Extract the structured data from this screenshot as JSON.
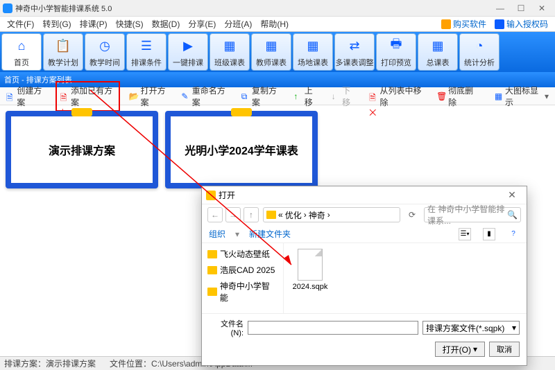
{
  "window": {
    "title": "神奇中小学智能排课系统 5.0"
  },
  "menu": {
    "file": "文件(F)",
    "goto": "转到(G)",
    "course": "排课(P)",
    "quick": "快捷(S)",
    "data": "数据(D)",
    "share": "分享(E)",
    "split": "分班(A)",
    "help": "帮助(H)",
    "buy": "购买软件",
    "enter_auth": "输入授权码"
  },
  "ribbon": {
    "home": "首页",
    "plan": "教学计划",
    "time": "教学时间",
    "cond": "排课条件",
    "auto": "一键排课",
    "class": "班级课表",
    "teacher": "教师课表",
    "venue": "场地课表",
    "adjust": "多课表调整",
    "preview": "打印预览",
    "overview": "总课表",
    "stat": "统计分析"
  },
  "breadcrumb": "首页 - 排课方案列表",
  "toolbar": {
    "create": "创建方案",
    "addexist": "添加已有方案",
    "open": "打开方案",
    "rename": "重命名方案",
    "copy": "复制方案",
    "up": "上移",
    "down": "下移",
    "remove": "从列表中移除",
    "delete": "彻底删除",
    "bigicon": "大图标显示"
  },
  "cards": {
    "demo": "演示排课方案",
    "guangming": "光明小学2024学年课表"
  },
  "status": {
    "plan_lbl": "排课方案：",
    "plan_val": "演示排课方案",
    "path_lbl": "文件位置：",
    "path_val": "C:\\Users\\admin\\AppData\\..."
  },
  "dlg": {
    "title": "打开",
    "back": "←",
    "fwd": "→",
    "up": "↑",
    "crumb1": "优化",
    "crumb2": "神奇",
    "sep": "›",
    "search_ph": "在 神奇中小学智能排课系...",
    "org": "组织",
    "newf": "新建文件夹",
    "side": {
      "a": "飞火动态壁纸",
      "b": "浩辰CAD 2025",
      "c": "神奇中小学智能"
    },
    "file": "2024.sqpk",
    "fname_lbl": "文件名(N):",
    "filter": "排课方案文件(*.sqpk)",
    "open": "打开(O)",
    "cancel": "取消"
  }
}
